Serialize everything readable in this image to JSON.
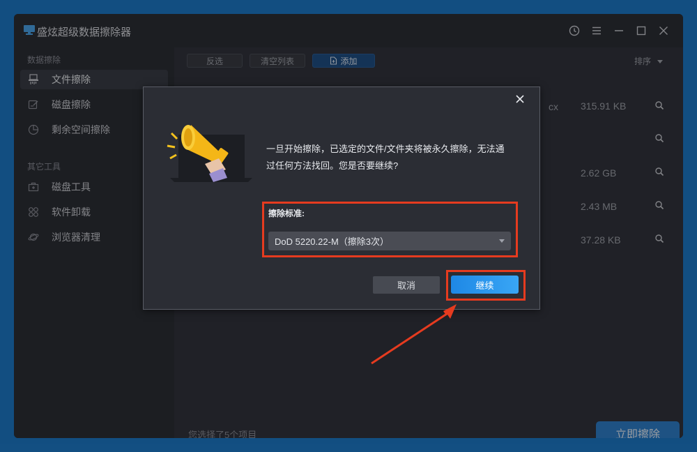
{
  "window": {
    "title": "盛炫超级数据擦除器",
    "titlebar_icons": [
      "history-icon",
      "menu-icon",
      "minimize-icon",
      "maximize-icon",
      "close-icon"
    ]
  },
  "sidebar": {
    "sections": [
      {
        "label": "数据擦除",
        "items": [
          {
            "label": "文件擦除",
            "icon": "file-shred-icon",
            "active": true
          },
          {
            "label": "磁盘擦除",
            "icon": "disk-erase-icon",
            "active": false
          },
          {
            "label": "剩余空间擦除",
            "icon": "pie-chart-icon",
            "active": false
          }
        ]
      },
      {
        "label": "其它工具",
        "items": [
          {
            "label": "磁盘工具",
            "icon": "toolbox-icon",
            "active": false
          },
          {
            "label": "软件卸载",
            "icon": "apps-grid-icon",
            "active": false
          },
          {
            "label": "浏览器清理",
            "icon": "planet-icon",
            "active": false
          }
        ]
      }
    ]
  },
  "toolbar": {
    "invert_label": "反选",
    "clear_label": "清空列表",
    "add_label": "添加",
    "sort_label": "排序"
  },
  "file_list": {
    "fragment_text": "cx",
    "sizes": [
      "315.91 KB",
      "",
      "2.62 GB",
      "2.43 MB",
      "37.28 KB"
    ]
  },
  "status": {
    "selected_text": "您选择了5个项目",
    "erase_button": "立即擦除"
  },
  "dialog": {
    "message": "一旦开始擦除，已选定的文件/文件夹将被永久擦除，无法通过任何方法找回。您是否要继续?",
    "standard_label": "擦除标准:",
    "standard_value": "DoD 5220.22-M（擦除3次）",
    "cancel_label": "取消",
    "continue_label": "继续"
  },
  "colors": {
    "accent": "#2e7fc9",
    "highlight": "#e63b1f",
    "background": "#1d79c7"
  }
}
